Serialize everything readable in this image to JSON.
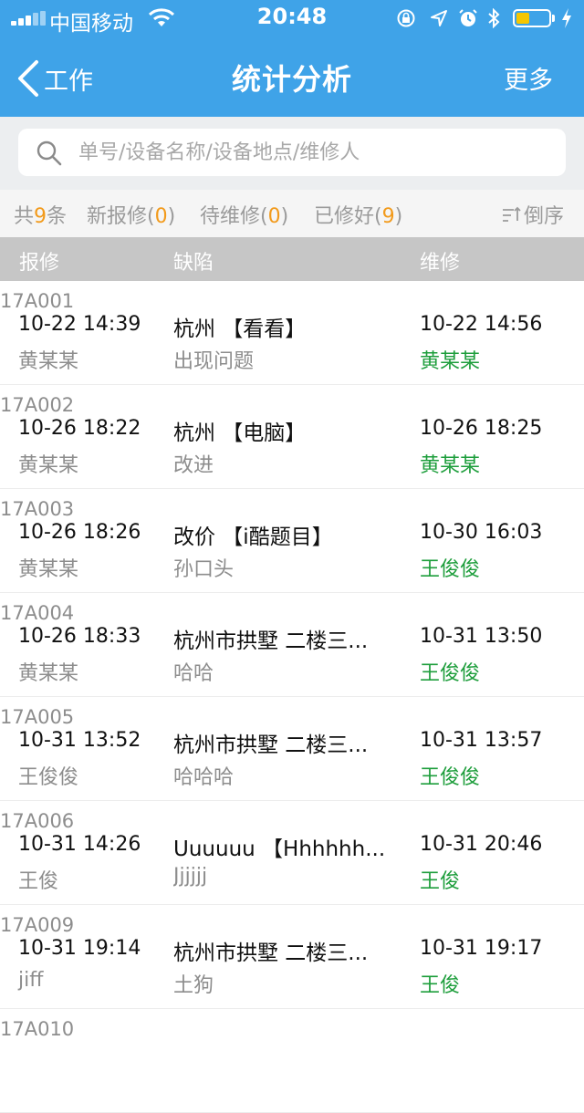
{
  "status_bar": {
    "carrier": "中国移动",
    "time": "20:48"
  },
  "nav": {
    "back_label": "工作",
    "title": "统计分析",
    "more_label": "更多"
  },
  "search": {
    "placeholder": "单号/设备名称/设备地点/维修人"
  },
  "filters": {
    "total_prefix": "共",
    "total_count": "9",
    "total_suffix": "条",
    "new_label": "新报修(",
    "new_count": "0",
    "pending_label": "待维修(",
    "pending_count": "0",
    "done_label": "已修好(",
    "done_count": "9",
    "close_paren": ")",
    "sort_label": "倒序"
  },
  "table": {
    "headers": {
      "report": "报修",
      "defect": "缺陷",
      "repair": "维修"
    },
    "rows": [
      {
        "id": "17A001",
        "report_time": "10-22 14:39",
        "reporter": "黄某某",
        "defect_title": "杭州 【看看】",
        "defect_desc": "出现问题",
        "repair_time": "10-22 14:56",
        "repairer": "黄某某"
      },
      {
        "id": "17A002",
        "report_time": "10-26 18:22",
        "reporter": "黄某某",
        "defect_title": "杭州 【电脑】",
        "defect_desc": "改进",
        "repair_time": "10-26 18:25",
        "repairer": "黄某某"
      },
      {
        "id": "17A003",
        "report_time": "10-26 18:26",
        "reporter": "黄某某",
        "defect_title": "改价 【i酷题目】",
        "defect_desc": "孙口头",
        "repair_time": "10-30 16:03",
        "repairer": "王俊俊"
      },
      {
        "id": "17A004",
        "report_time": "10-26 18:33",
        "reporter": "黄某某",
        "defect_title": "杭州市拱墅 二楼三...",
        "defect_desc": "哈哈",
        "repair_time": "10-31 13:50",
        "repairer": "王俊俊"
      },
      {
        "id": "17A005",
        "report_time": "10-31 13:52",
        "reporter": "王俊俊",
        "defect_title": "杭州市拱墅 二楼三...",
        "defect_desc": "哈哈哈",
        "repair_time": "10-31 13:57",
        "repairer": "王俊俊"
      },
      {
        "id": "17A006",
        "report_time": "10-31 14:26",
        "reporter": "王俊",
        "defect_title": "Uuuuuu 【Hhhhhh...",
        "defect_desc": "Jjjjjj",
        "repair_time": "10-31 20:46",
        "repairer": "王俊"
      },
      {
        "id": "17A009",
        "report_time": "10-31 19:14",
        "reporter": "jiff",
        "defect_title": "杭州市拱墅 二楼三...",
        "defect_desc": "土狗",
        "repair_time": "10-31 19:17",
        "repairer": "王俊"
      },
      {
        "id": "17A010",
        "report_time": "",
        "reporter": "",
        "defect_title": "",
        "defect_desc": "",
        "repair_time": "",
        "repairer": ""
      }
    ]
  },
  "colors": {
    "nav_blue": "#3fa3e8",
    "count_orange": "#f29a1b",
    "repairer_green": "#1e9e3c",
    "header_gray": "#c6c6c6"
  }
}
